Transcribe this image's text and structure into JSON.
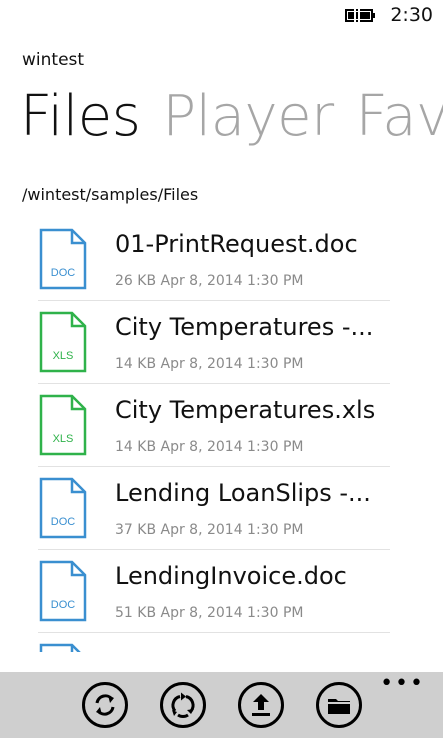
{
  "status": {
    "time": "2:30",
    "battery_icon": "battery-charging-icon"
  },
  "app": {
    "title": "wintest"
  },
  "pivot": {
    "items": [
      "Files",
      "Player",
      "Fav"
    ],
    "active_index": 0
  },
  "path": "/wintest/samples/Files",
  "colors": {
    "doc": "#3a8fd0",
    "xls": "#2fb24a",
    "inactive": "#a6a6a6",
    "appbar": "#cfcfcf"
  },
  "files": [
    {
      "name": "01-PrintRequest.doc",
      "meta": "26 KB Apr 8, 2014 1:30 PM",
      "type": "DOC",
      "icon": "doc-file-icon"
    },
    {
      "name": "City Temperatures -...",
      "meta": "14 KB Apr 8, 2014 1:30 PM",
      "type": "XLS",
      "icon": "xls-file-icon"
    },
    {
      "name": "City Temperatures.xls",
      "meta": "14 KB Apr 8, 2014 1:30 PM",
      "type": "XLS",
      "icon": "xls-file-icon"
    },
    {
      "name": "Lending LoanSlips -...",
      "meta": "37 KB Apr 8, 2014 1:30 PM",
      "type": "DOC",
      "icon": "doc-file-icon"
    },
    {
      "name": "LendingInvoice.doc",
      "meta": "51 KB Apr 8, 2014 1:30 PM",
      "type": "DOC",
      "icon": "doc-file-icon"
    }
  ],
  "app_bar": {
    "buttons": [
      {
        "name": "refresh-button",
        "icon": "refresh-icon"
      },
      {
        "name": "sync-button",
        "icon": "sync-icon"
      },
      {
        "name": "upload-button",
        "icon": "upload-icon"
      },
      {
        "name": "folder-button",
        "icon": "folder-icon"
      }
    ],
    "more": "•••"
  }
}
